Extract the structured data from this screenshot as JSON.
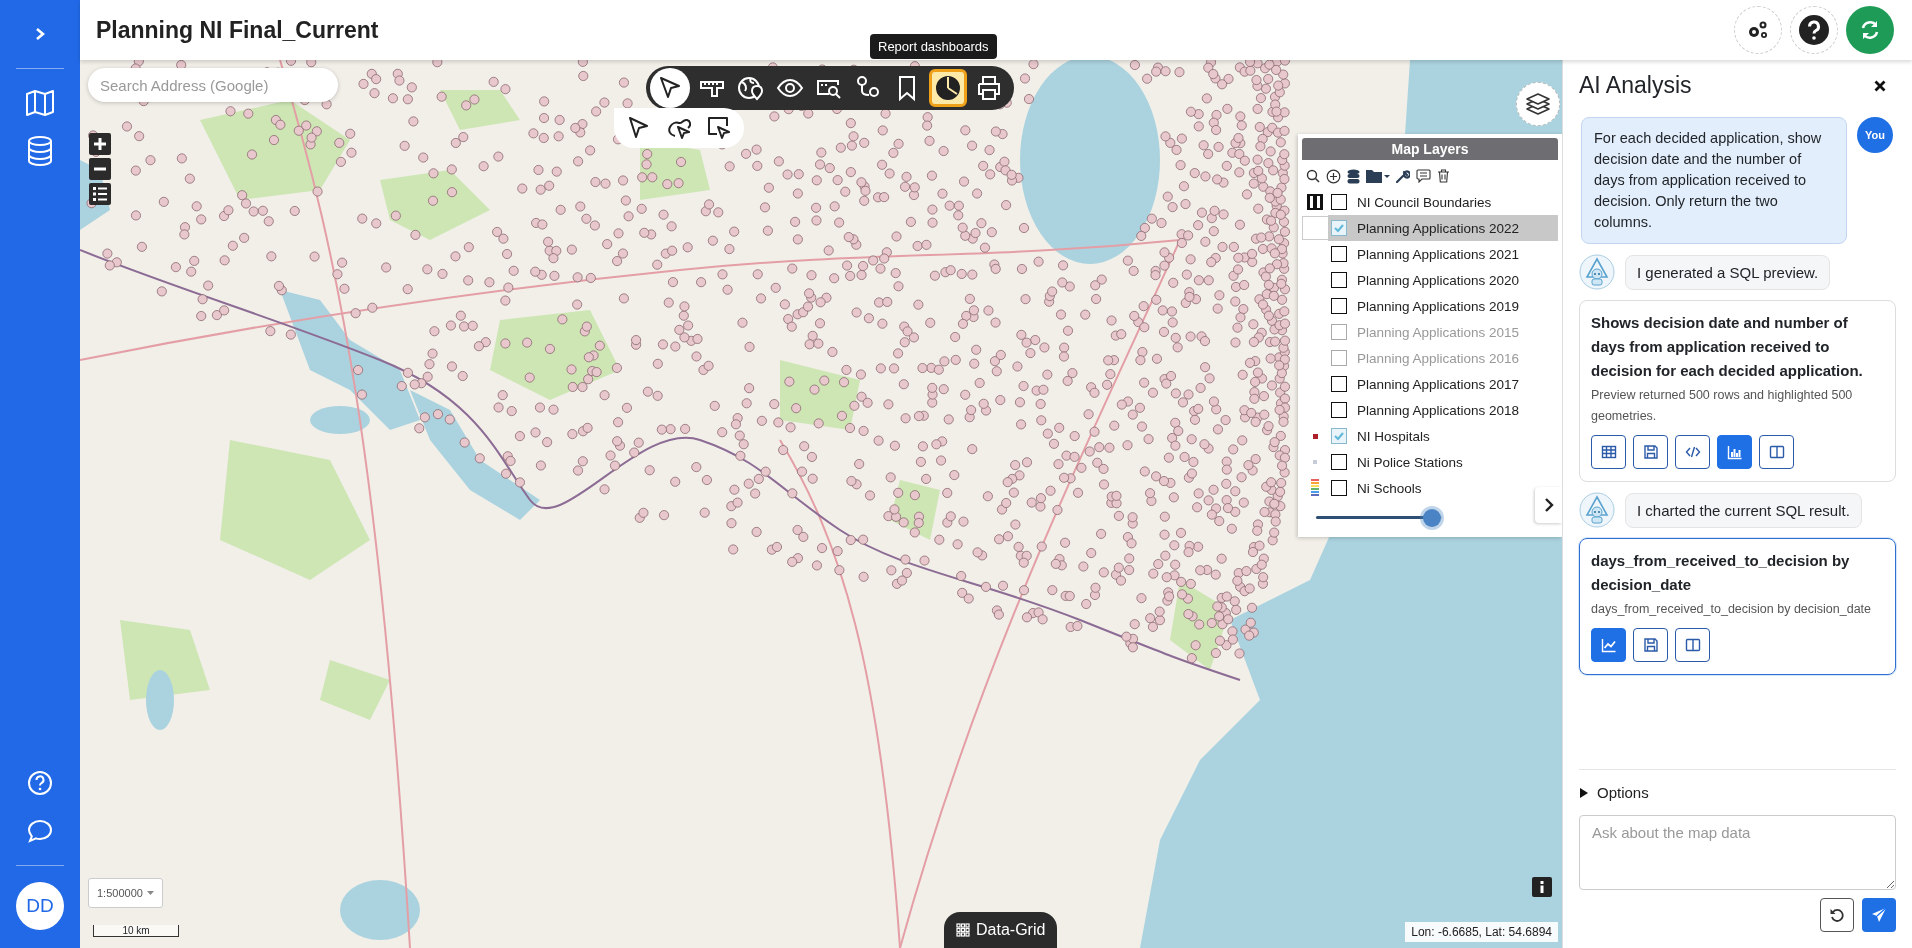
{
  "header": {
    "title": "Planning NI Final_Current"
  },
  "user": {
    "initials": "DD"
  },
  "map": {
    "search": {
      "placeholder": "Search Address (Google)"
    },
    "tools": [
      {
        "kind": "pointer",
        "expanded": true,
        "selected": false
      },
      {
        "kind": "ruler",
        "expanded": false,
        "selected": false
      },
      {
        "kind": "globe-pin",
        "expanded": false,
        "selected": false
      },
      {
        "kind": "eye",
        "expanded": false,
        "selected": false
      },
      {
        "kind": "search-window",
        "expanded": false,
        "selected": false
      },
      {
        "kind": "route",
        "expanded": false,
        "selected": false
      },
      {
        "kind": "bookmark",
        "expanded": false,
        "selected": false
      },
      {
        "kind": "pie",
        "expanded": false,
        "selected": true
      },
      {
        "kind": "printer",
        "expanded": false,
        "selected": false
      }
    ],
    "tooltip": "Report dashboards",
    "scale_select": "1:500000",
    "scale_bar": "10 km",
    "data_grid_button": "Data-Grid",
    "coordinates": "Lon: -6.6685, Lat: 54.6894"
  },
  "layers_panel": {
    "title": "Map Layers",
    "layers": [
      {
        "label": "NI Council Boundaries",
        "kind": "boundary",
        "checked": false,
        "disabled": false,
        "selected": false
      },
      {
        "label": "Planning Applications 2022",
        "kind": "blank",
        "checked": true,
        "disabled": false,
        "selected": true
      },
      {
        "label": "Planning Applications 2021",
        "kind": "none",
        "checked": false,
        "disabled": false,
        "selected": false
      },
      {
        "label": "Planning Applications 2020",
        "kind": "none",
        "checked": false,
        "disabled": false,
        "selected": false
      },
      {
        "label": "Planning Applications 2019",
        "kind": "none",
        "checked": false,
        "disabled": false,
        "selected": false
      },
      {
        "label": "Planning Applications 2015",
        "kind": "none",
        "checked": false,
        "disabled": true,
        "selected": false
      },
      {
        "label": "Planning Applications 2016",
        "kind": "none",
        "checked": false,
        "disabled": true,
        "selected": false
      },
      {
        "label": "Planning Applications 2017",
        "kind": "none",
        "checked": false,
        "disabled": false,
        "selected": false
      },
      {
        "label": "Planning Applications 2018",
        "kind": "none",
        "checked": false,
        "disabled": false,
        "selected": false
      },
      {
        "label": "NI Hospitals",
        "kind": "dot",
        "checked": true,
        "disabled": false,
        "selected": false
      },
      {
        "label": "Ni Police Stations",
        "kind": "faint-dot",
        "checked": false,
        "disabled": false,
        "selected": false
      },
      {
        "label": "Ni Schools",
        "kind": "stripes",
        "checked": false,
        "disabled": false,
        "selected": false
      }
    ],
    "opacity": {
      "level": 0.92
    }
  },
  "ai_panel": {
    "title": "AI Analysis",
    "messages": [
      {
        "kind": "user",
        "avatar": "You",
        "text": "For each decided application, show decision date and the number of days from application received to decision. Only return the two columns."
      },
      {
        "kind": "bot",
        "text": "I generated a SQL preview."
      },
      {
        "kind": "card",
        "selected": false,
        "title": "Shows decision date and number of days from application received to decision for each decided application.",
        "description": "Preview returned 500 rows and highlighted 500 geometries.",
        "buttons": [
          {
            "kind": "table",
            "selected": false
          },
          {
            "kind": "save",
            "selected": false
          },
          {
            "kind": "code",
            "selected": false
          },
          {
            "kind": "bar-chart",
            "selected": true
          },
          {
            "kind": "split",
            "selected": false
          }
        ]
      },
      {
        "kind": "bot",
        "text": "I charted the current SQL result."
      },
      {
        "kind": "card",
        "selected": true,
        "title": "days_from_received_to_decision by decision_date",
        "description": "days_from_received_to_decision by decision_date",
        "buttons": [
          {
            "kind": "line-chart",
            "selected": true
          },
          {
            "kind": "save",
            "selected": false
          },
          {
            "kind": "split",
            "selected": false
          }
        ]
      }
    ],
    "options": {
      "label": "Options",
      "expanded": false
    },
    "input": {
      "placeholder": "Ask about the map data"
    }
  }
}
